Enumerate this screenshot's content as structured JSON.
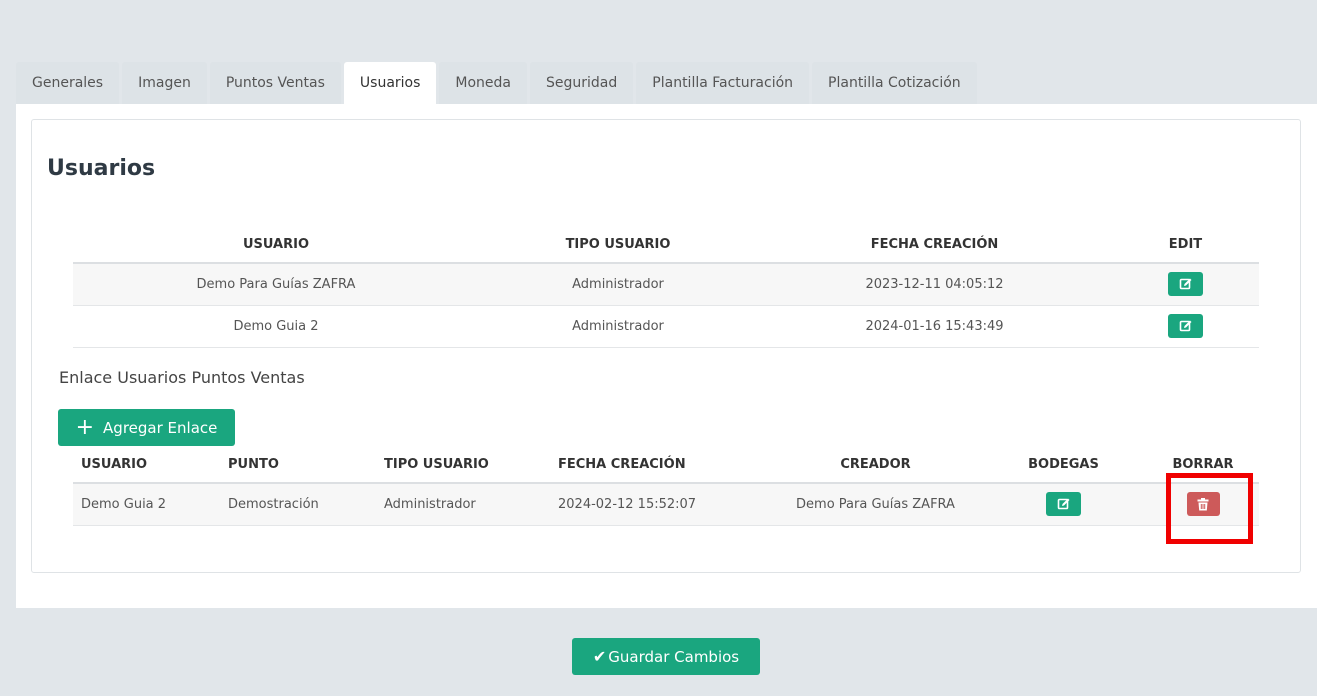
{
  "tabs": [
    "Generales",
    "Imagen",
    "Puntos Ventas",
    "Usuarios",
    "Moneda",
    "Seguridad",
    "Plantilla Facturación",
    "Plantilla Cotización"
  ],
  "active_tab": "Usuarios",
  "page_title": "Usuarios",
  "users_table": {
    "headers": [
      "USUARIO",
      "TIPO USUARIO",
      "FECHA CREACIÓN",
      "EDIT"
    ],
    "rows": [
      {
        "usuario": "Demo Para Guías ZAFRA",
        "tipo": "Administrador",
        "fecha": "2023-12-11 04:05:12"
      },
      {
        "usuario": "Demo Guia 2",
        "tipo": "Administrador",
        "fecha": "2024-01-16 15:43:49"
      }
    ]
  },
  "links_section": {
    "title": "Enlace Usuarios Puntos Ventas",
    "add_button": "Agregar Enlace",
    "headers": [
      "USUARIO",
      "PUNTO",
      "TIPO USUARIO",
      "FECHA CREACIÓN",
      "CREADOR",
      "BODEGAS",
      "BORRAR"
    ],
    "rows": [
      {
        "usuario": "Demo Guia 2",
        "punto": "Demostración",
        "tipo": "Administrador",
        "fecha": "2024-02-12 15:52:07",
        "creador": "Demo Para Guías ZAFRA"
      }
    ]
  },
  "save_button": "Guardar Cambios",
  "icons": {
    "add": "plus-icon",
    "edit": "edit-icon",
    "delete": "trash-icon",
    "save": "check-icon"
  },
  "colors": {
    "primary": "#1aa67f",
    "danger": "#cd5a5a",
    "highlight": "#f00000",
    "background": "#e1e6ea"
  }
}
